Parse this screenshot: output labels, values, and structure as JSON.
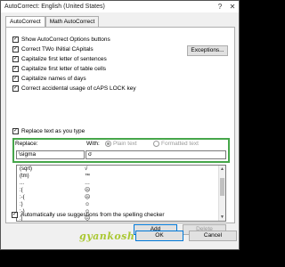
{
  "window": {
    "title": "AutoCorrect: English (United States)",
    "help_glyph": "?",
    "close_glyph": "✕"
  },
  "tabs": [
    {
      "label": "AutoCorrect"
    },
    {
      "label": "Math AutoCorrect"
    }
  ],
  "options": [
    {
      "label": "Show AutoCorrect Options buttons",
      "checked": true
    },
    {
      "label": "Correct TWo INitial CApitals",
      "checked": true
    },
    {
      "label": "Capitalize first letter of sentences",
      "checked": true
    },
    {
      "label": "Capitalize first letter of table cells",
      "checked": true
    },
    {
      "label": "Capitalize names of days",
      "checked": true
    },
    {
      "label": "Correct accidental usage of cAPS LOCK key",
      "checked": true
    }
  ],
  "exceptions_label": "Exceptions...",
  "replace_as_you_type": {
    "label": "Replace text as you type",
    "checked": true
  },
  "replace_label": "Replace:",
  "with_label": "With:",
  "plain_text_label": "Plain text",
  "formatted_text_label": "Formatted text",
  "replace_value": "\\sigma",
  "with_value": "σ",
  "table_rows": [
    {
      "from": "(sqrt)",
      "to": "√"
    },
    {
      "from": "(tm)",
      "to": "™"
    },
    {
      "from": "...",
      "to": "…"
    },
    {
      "from": ":(",
      "to": "☹"
    },
    {
      "from": ":-(",
      "to": "☹"
    },
    {
      "from": ":)",
      "to": "☺"
    },
    {
      "from": ":-)",
      "to": "☺"
    },
    {
      "from": ":|",
      "to": "😐"
    }
  ],
  "check_glyph": "✓",
  "scroll_up_glyph": "▲",
  "scroll_down_glyph": "▼",
  "add_label": "Add",
  "delete_label": "Delete",
  "auto_suggest": {
    "label": "Automatically use suggestions from the spelling checker",
    "checked": true
  },
  "ok_label": "OK",
  "cancel_label": "Cancel",
  "watermark": "gyankosh.net"
}
